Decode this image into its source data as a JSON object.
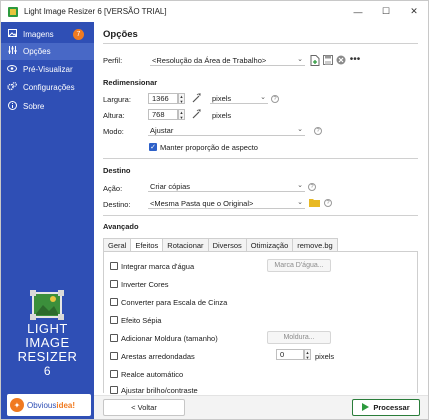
{
  "window": {
    "title": "Light Image Resizer 6  [VERSÃO TRIAL]",
    "minimize_glyph": "—",
    "maximize_glyph": "☐",
    "close_glyph": "✕"
  },
  "sidebar": {
    "items": [
      {
        "label": "Imagens",
        "icon": "images-icon",
        "badge": "7"
      },
      {
        "label": "Opções",
        "icon": "sliders-icon"
      },
      {
        "label": "Pré-Visualizar",
        "icon": "eye-icon"
      },
      {
        "label": "Configurações",
        "icon": "gears-icon"
      },
      {
        "label": "Sobre",
        "icon": "info-icon"
      }
    ],
    "logo_lines": [
      "LIGHT",
      "IMAGE",
      "RESIZER",
      "6"
    ],
    "brand_prefix": "Obvious",
    "brand_suffix": "idea!",
    "colors": {
      "background": "#2f4fb5",
      "active": "#4868c6",
      "accent": "#f07a20"
    }
  },
  "main": {
    "title": "Opções",
    "profile": {
      "label": "Perfil:",
      "value": "<Resolução da Área de Trabalho>"
    },
    "resize": {
      "section": "Redimensionar",
      "width_label": "Largura:",
      "width_value": "1366",
      "unit_value": "pixels",
      "height_label": "Altura:",
      "height_value": "768",
      "height_unit": "pixels",
      "mode_label": "Modo:",
      "mode_value": "Ajustar",
      "keep_aspect_label": "Manter proporção de aspecto",
      "keep_aspect_checked": true
    },
    "destination": {
      "section": "Destino",
      "action_label": "Ação:",
      "action_value": "Criar cópias",
      "dest_label": "Destino:",
      "dest_value": "<Mesma Pasta que o Original>"
    },
    "advanced": {
      "section": "Avançado",
      "tabs": [
        "Geral",
        "Efeitos",
        "Rotacionar",
        "Diversos",
        "Otimização",
        "remove.bg"
      ],
      "active_tab": "Efeitos",
      "effects": [
        {
          "label": "Integrar marca d'água",
          "checked": false
        },
        {
          "label": "Inverter Cores",
          "checked": false
        },
        {
          "label": "Converter para Escala de Cinza",
          "checked": false
        },
        {
          "label": "Efeito Sépia",
          "checked": false
        },
        {
          "label": "Adicionar Moldura (tamanho)",
          "checked": false
        },
        {
          "label": "Arestas arredondadas",
          "checked": false
        },
        {
          "label": "Realce automático",
          "checked": false
        },
        {
          "label": "Ajustar brilho/contraste",
          "checked": false
        }
      ],
      "watermark_button": "Marca D'água...",
      "frame_button": "Moldura...",
      "rounded_value": "0",
      "rounded_unit": "pixels"
    },
    "footer": {
      "back_label": "< Voltar",
      "process_label": "Processar"
    }
  }
}
